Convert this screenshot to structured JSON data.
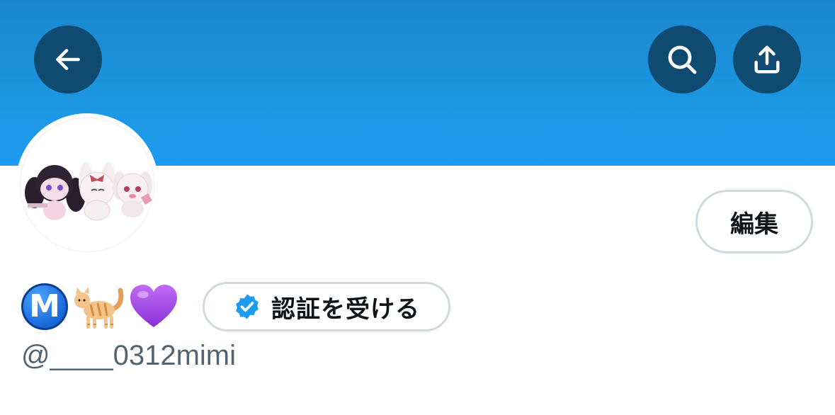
{
  "header": {
    "back_icon": "arrow-left-icon",
    "search_icon": "search-icon",
    "share_icon": "share-icon",
    "banner_color": "#1d9bf0",
    "button_color": "#0f4a70"
  },
  "profile": {
    "display_name_emojis": [
      "Ⓜ️",
      "🐈",
      "💜"
    ],
    "m_letter": "M",
    "handle": "@____0312mimi",
    "edit_button_label": "編集",
    "verify_button_label": "認証を受ける",
    "verify_icon": "verified-badge-icon",
    "verify_color": "#1d9bf0"
  }
}
